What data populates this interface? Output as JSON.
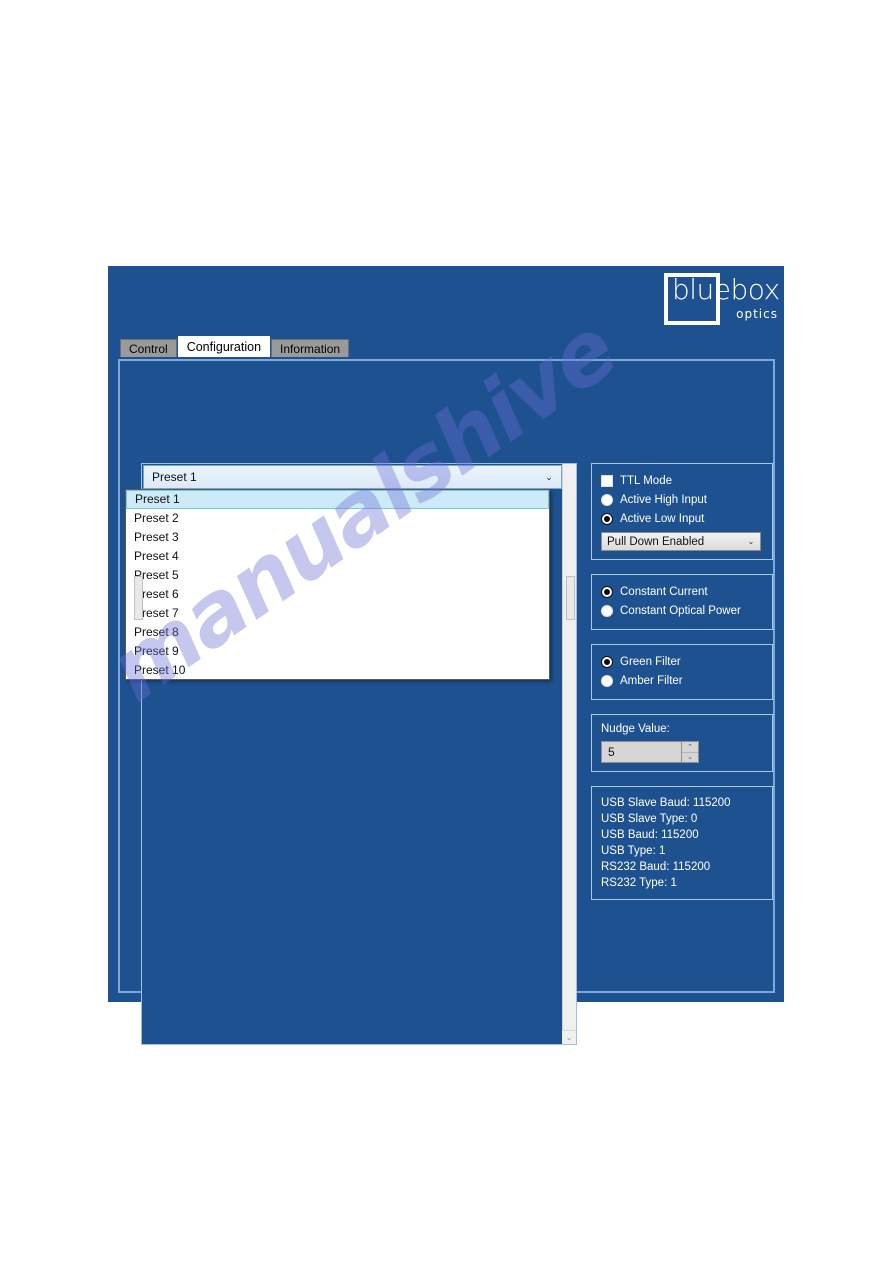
{
  "window": {
    "logo": {
      "wordmark": "bluebox",
      "tagline": "optics"
    },
    "tabs": [
      {
        "label": "Control",
        "active": false
      },
      {
        "label": "Configuration",
        "active": true
      },
      {
        "label": "Information",
        "active": false
      }
    ]
  },
  "preset_selector": {
    "selected": "Preset 1",
    "expanded": true,
    "options": [
      "Preset 1",
      "Preset 2",
      "Preset 3",
      "Preset 4",
      "Preset 5",
      "Preset 6",
      "Preset 7",
      "Preset 8",
      "Preset 9",
      "Preset 10"
    ]
  },
  "ttl_group": {
    "checkbox_label": "TTL Mode",
    "checkbox_checked": false,
    "radios": [
      {
        "label": "Active High Input",
        "selected": false
      },
      {
        "label": "Active Low Input",
        "selected": true
      }
    ],
    "pulldown_value": "Pull Down Enabled"
  },
  "drive_mode_group": {
    "radios": [
      {
        "label": "Constant Current",
        "selected": true
      },
      {
        "label": "Constant Optical Power",
        "selected": false
      }
    ]
  },
  "filter_group": {
    "radios": [
      {
        "label": "Green Filter",
        "selected": true
      },
      {
        "label": "Amber Filter",
        "selected": false
      }
    ]
  },
  "nudge_group": {
    "title": "Nudge Value:",
    "value": "5",
    "spinner_up": "⌃",
    "spinner_down": "⌄"
  },
  "info_group": {
    "lines": [
      "USB Slave Baud: 115200",
      "USB Slave Type: 0",
      "USB Baud: 115200",
      "USB Type: 1",
      "RS232 Baud: 115200",
      "RS232 Type: 1"
    ]
  },
  "icons": {
    "combo_arrow": "⌄",
    "scroll_down_arrow": "⌄"
  },
  "watermark": {
    "text": "manualshive"
  },
  "colors": {
    "window_blue": "#1e518f",
    "panel_border": "#9cc0e4",
    "tab_inactive": "#9a9a9a",
    "combo_highlight": "#cdeaf7",
    "watermark": "#6a6fd6"
  }
}
